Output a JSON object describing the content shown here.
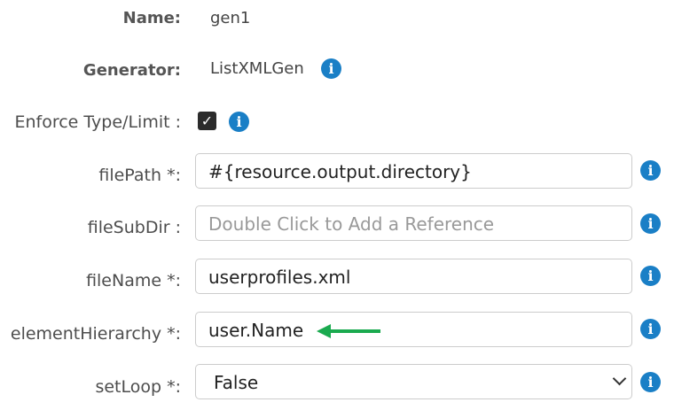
{
  "form": {
    "name": {
      "label": "Name:",
      "value": "gen1"
    },
    "generator": {
      "label": "Generator:",
      "value": "ListXMLGen"
    },
    "enforce": {
      "label": "Enforce Type/Limit :",
      "checked": true
    },
    "filePath": {
      "label": "filePath *:",
      "value": "#{resource.output.directory}"
    },
    "fileSubDir": {
      "label": "fileSubDir :",
      "placeholder": "Double Click to Add a Reference"
    },
    "fileName": {
      "label": "fileName *:",
      "value": "userprofiles.xml"
    },
    "elementHierarchy": {
      "label": "elementHierarchy *:",
      "value": "user.Name"
    },
    "setLoop": {
      "label": "setLoop *:",
      "selected": "False"
    }
  },
  "icons": {
    "info": "info-icon",
    "check": "checkmark-icon",
    "arrow": "arrow-left-icon",
    "dropdown": "chevron-down-icon"
  },
  "colors": {
    "info": "#1a7fc6",
    "arrow": "#1aaa4f"
  }
}
